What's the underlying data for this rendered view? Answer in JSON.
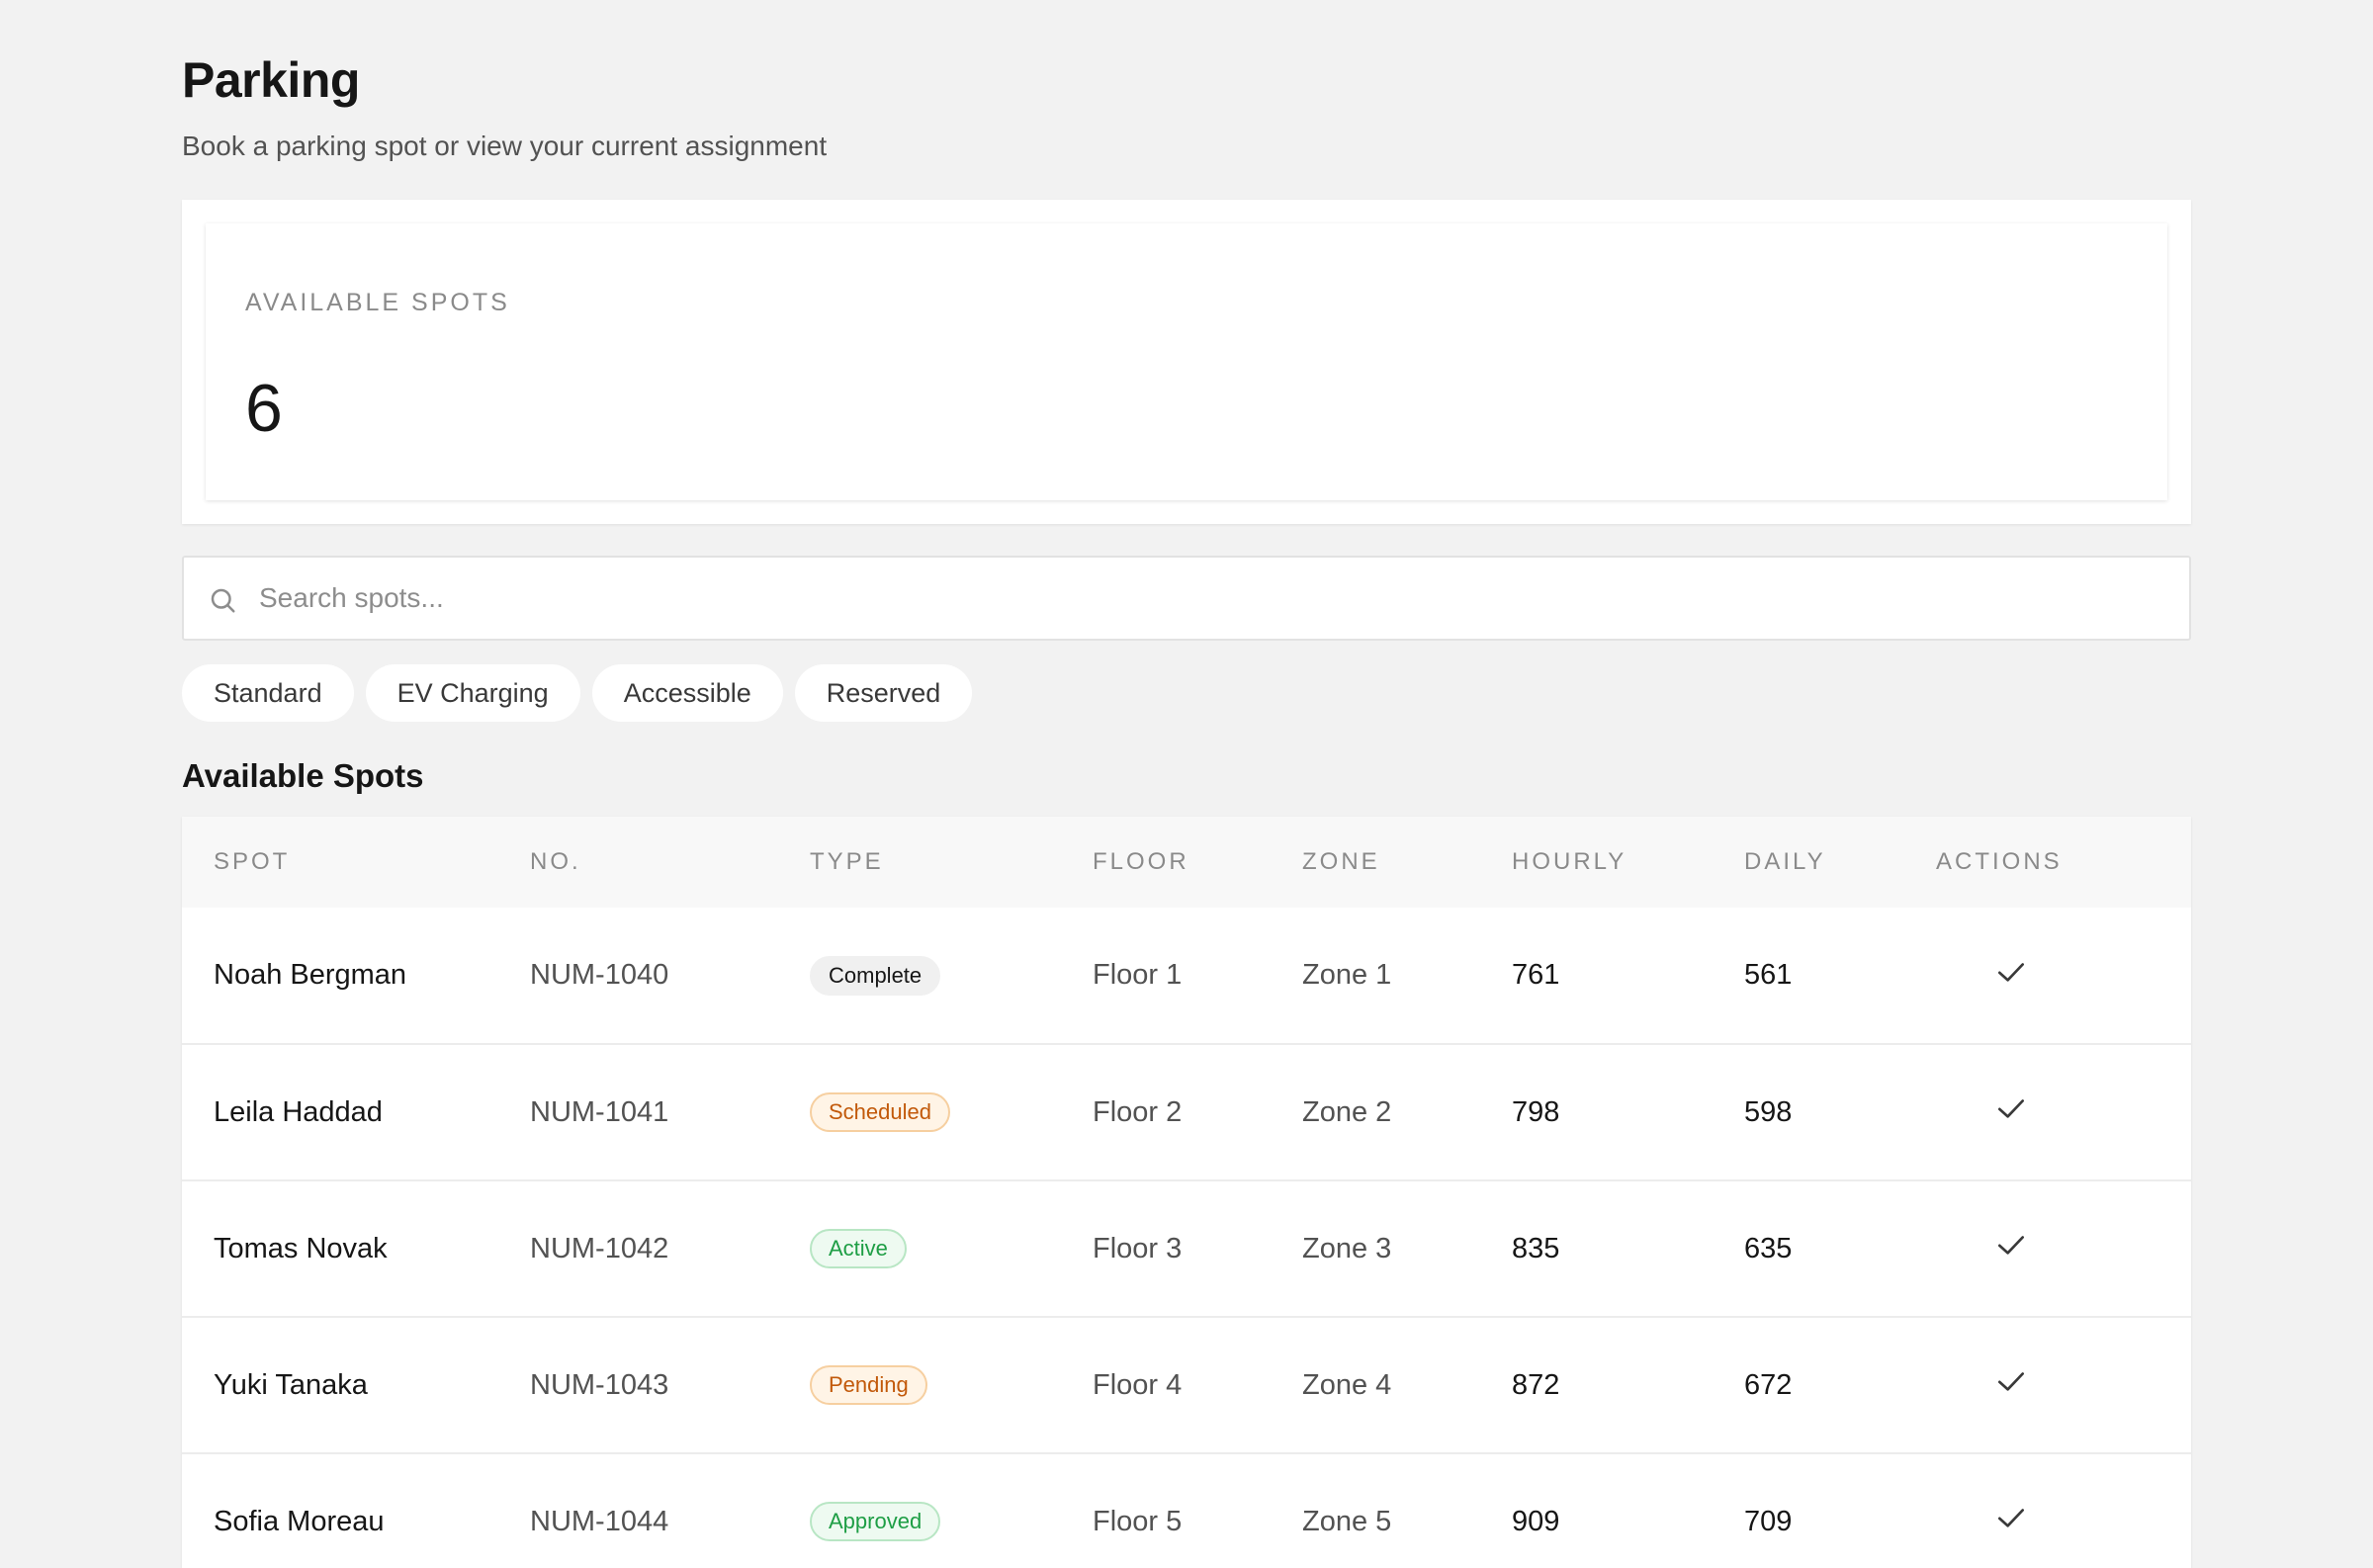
{
  "header": {
    "title": "Parking",
    "subtitle": "Book a parking spot or view your current assignment"
  },
  "stat": {
    "label": "AVAILABLE SPOTS",
    "value": "6"
  },
  "search": {
    "placeholder": "Search spots...",
    "value": ""
  },
  "filters": [
    "Standard",
    "EV Charging",
    "Accessible",
    "Reserved"
  ],
  "table": {
    "title": "Available Spots",
    "columns": [
      "SPOT",
      "NO.",
      "TYPE",
      "FLOOR",
      "ZONE",
      "HOURLY",
      "DAILY",
      "ACTIONS"
    ],
    "rows": [
      {
        "spot": "Noah Bergman",
        "no": "NUM-1040",
        "type": "Complete",
        "floor": "Floor 1",
        "zone": "Zone 1",
        "hourly": "761",
        "daily": "561"
      },
      {
        "spot": "Leila Haddad",
        "no": "NUM-1041",
        "type": "Scheduled",
        "floor": "Floor 2",
        "zone": "Zone 2",
        "hourly": "798",
        "daily": "598"
      },
      {
        "spot": "Tomas Novak",
        "no": "NUM-1042",
        "type": "Active",
        "floor": "Floor 3",
        "zone": "Zone 3",
        "hourly": "835",
        "daily": "635"
      },
      {
        "spot": "Yuki Tanaka",
        "no": "NUM-1043",
        "type": "Pending",
        "floor": "Floor 4",
        "zone": "Zone 4",
        "hourly": "872",
        "daily": "672"
      },
      {
        "spot": "Sofia Moreau",
        "no": "NUM-1044",
        "type": "Approved",
        "floor": "Floor 5",
        "zone": "Zone 5",
        "hourly": "909",
        "daily": "709"
      }
    ]
  },
  "icons": {
    "search": "search-icon",
    "action": "check-icon"
  },
  "colors": {
    "background": "#f2f2f2",
    "card": "#ffffff",
    "text": "#161616",
    "muted": "#525252",
    "orange_status": "#c2590a",
    "green_status": "#1e9e45"
  }
}
